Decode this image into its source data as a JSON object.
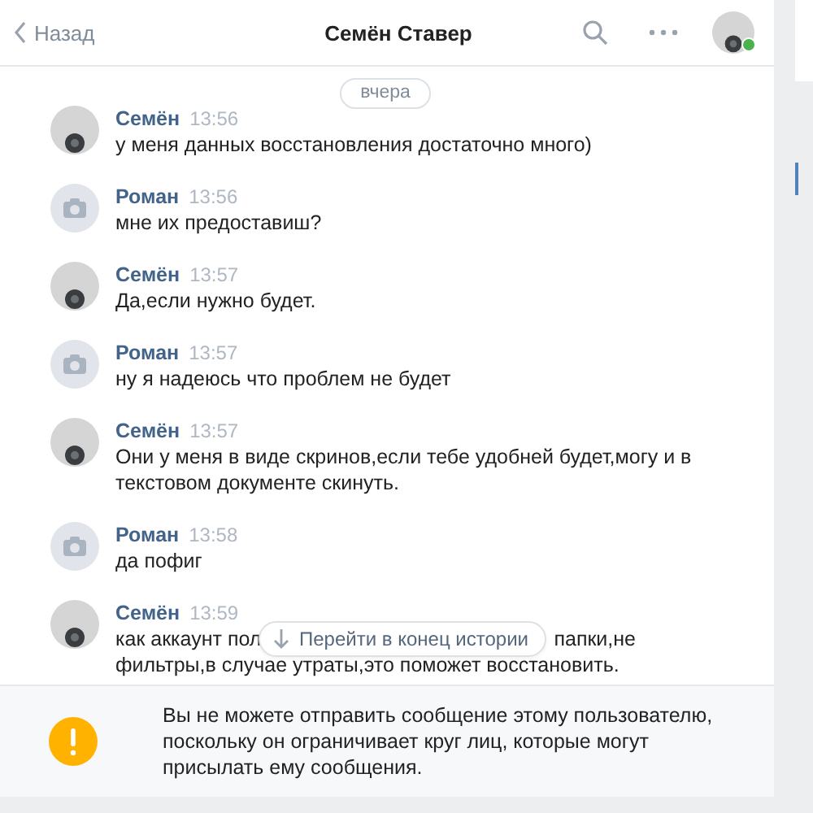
{
  "header": {
    "back": "Назад",
    "title": "Семён Ставер",
    "online": true
  },
  "date_divider": "вчера",
  "messages": [
    {
      "author": "Семён",
      "kind": "photo",
      "time": "13:56",
      "lines": [
        "у меня данных восстановления достаточно много)"
      ]
    },
    {
      "author": "Роман",
      "kind": "camera",
      "time": "13:56",
      "lines": [
        "мне их предоставиш?"
      ]
    },
    {
      "author": "Семён",
      "kind": "photo",
      "time": "13:57",
      "lines": [
        "Да,если нужно будет."
      ]
    },
    {
      "author": "Роман",
      "kind": "camera",
      "time": "13:57",
      "lines": [
        "ну я надеюсь что проблем не будет"
      ]
    },
    {
      "author": "Семён",
      "kind": "photo",
      "time": "13:57",
      "lines": [
        "Они у меня в виде скринов,если тебе удобней будет,могу и в",
        "текстовом документе скинуть."
      ]
    },
    {
      "author": "Роман",
      "kind": "camera",
      "time": "13:58",
      "lines": [
        "да пофиг"
      ]
    },
    {
      "author": "Семён",
      "kind": "photo",
      "time": "13:59",
      "lines": [
        [
          "как аккаунт пол",
          "папки,не"
        ],
        "фильтры,в случае утраты,это поможет восстановить."
      ]
    }
  ],
  "jump_button": "Перейти в конец истории",
  "notice": "Вы не можете отправить сообщение этому пользователю, поскольку он ограничивает круг лиц, которые могут присылать ему сообщения."
}
